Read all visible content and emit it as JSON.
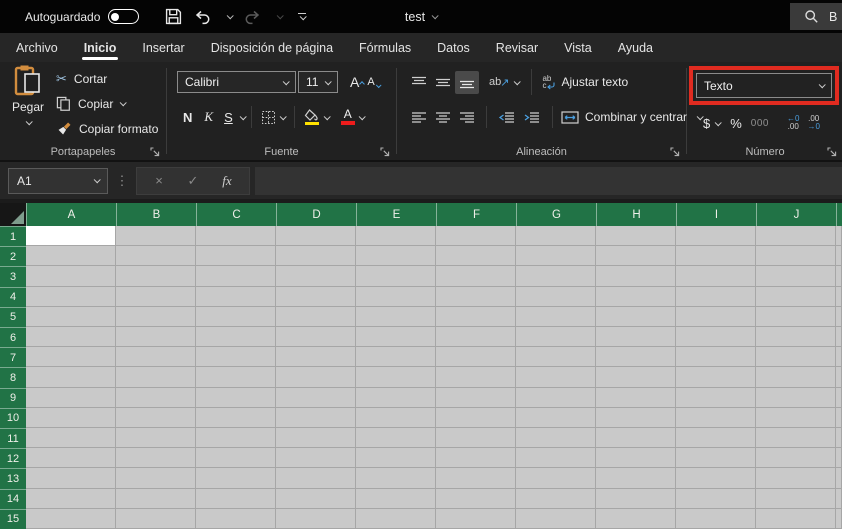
{
  "titlebar": {
    "autosave": "Autoguardado",
    "title": "test",
    "search": "B"
  },
  "tabs": [
    "Archivo",
    "Inicio",
    "Insertar",
    "Disposición de página",
    "Fórmulas",
    "Datos",
    "Revisar",
    "Vista",
    "Ayuda"
  ],
  "active_tab": "Inicio",
  "ribbon": {
    "clipboard": {
      "label": "Portapapeles",
      "paste": "Pegar",
      "cut": "Cortar",
      "copy": "Copiar",
      "format_painter": "Copiar formato"
    },
    "font": {
      "label": "Fuente",
      "name": "Calibri",
      "size": "11",
      "bold": "N",
      "italic": "K",
      "underline": "S",
      "grow": "A",
      "shrink": "A",
      "font_color_letter": "A"
    },
    "alignment": {
      "label": "Alineación",
      "wrap": "Ajustar texto",
      "merge": "Combinar y centrar"
    },
    "number": {
      "label": "Número",
      "format": "Texto",
      "currency": "$",
      "percent": "%",
      "thousands": "000",
      "inc_decimal_top": "←0",
      "inc_decimal_bottom": ".00",
      "dec_decimal_top": ".00",
      "dec_decimal_bottom": "→0"
    }
  },
  "icons": {
    "scissors": "✂",
    "orientation_text": "ab",
    "orientation_arrow": "↗",
    "wrap_line1": "ab",
    "wrap_line2": "c",
    "dots": "⋮",
    "cancel": "×",
    "check": "✓",
    "fx": "fx"
  },
  "formula_bar": {
    "cell_reference": "A1"
  },
  "grid": {
    "columns": [
      "A",
      "B",
      "C",
      "D",
      "E",
      "F",
      "G",
      "H",
      "I",
      "J"
    ],
    "rows": [
      "1",
      "2",
      "3",
      "4",
      "5",
      "6",
      "7",
      "8",
      "9",
      "10",
      "11",
      "12",
      "13",
      "14",
      "15"
    ],
    "active_cell": "A1"
  },
  "colors": {
    "header_green": "#217346",
    "highlight_red": "#e02b20",
    "accent_blue": "#4a9ede",
    "fill_yellow": "#ffe100",
    "font_red": "#ed1c1c",
    "clipboard_orange": "#d28d3e"
  }
}
